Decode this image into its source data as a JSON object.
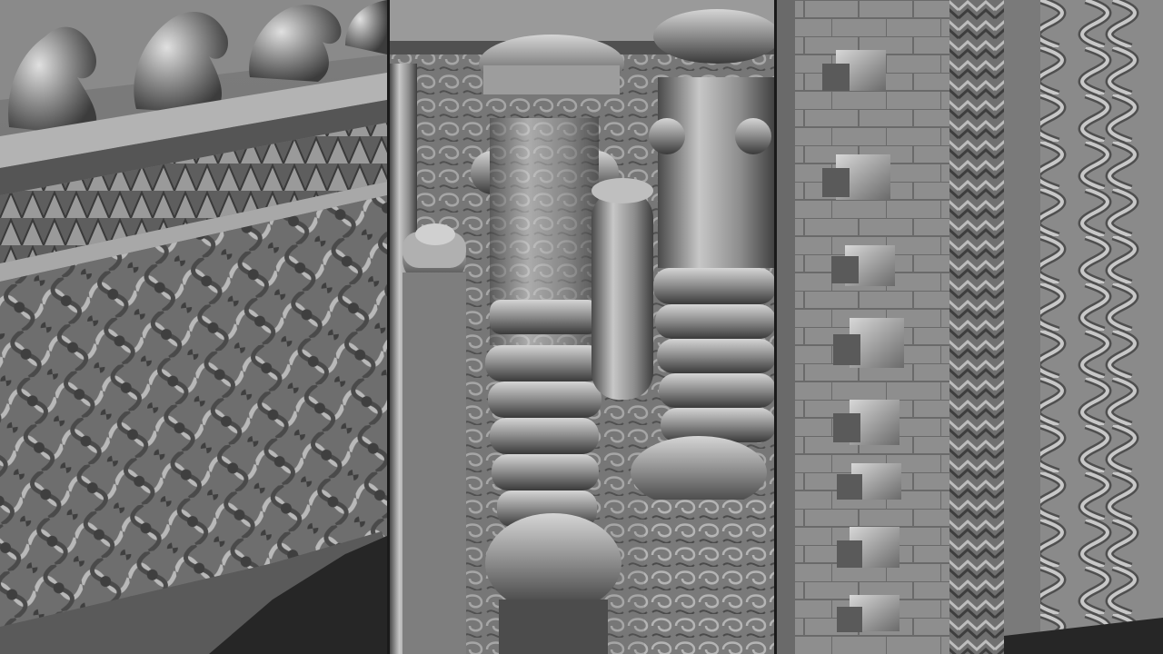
{
  "composition": {
    "panels": [
      {
        "subject": "carved-frieze-with-horse-sculptures-and-lattice-panel"
      },
      {
        "subject": "carved-columns-with-ringed-shafts-and-faces"
      },
      {
        "subject": "stone-wall-with-stepped-brackets-and-serpentine-relief"
      }
    ],
    "colors": {
      "sculpt": "#8e8e8e",
      "shadow": "#4a4a4a",
      "highlight": "#d2d2d2",
      "void": "#232323",
      "divider": "#1a1a1a"
    }
  }
}
